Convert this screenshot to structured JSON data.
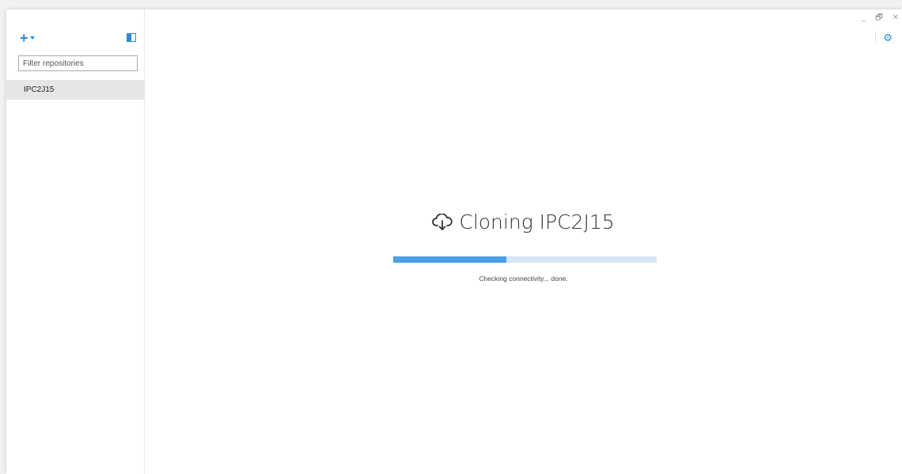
{
  "sidebar": {
    "add_button_icon": "plus-icon",
    "toggle_icon": "sidebar-toggle-icon",
    "filter": {
      "placeholder": "Filter repositories",
      "value": ""
    },
    "repositories": [
      {
        "label": "IPC2J15",
        "selected": true
      }
    ]
  },
  "window_controls": {
    "minimize": "_",
    "restore": "🗗",
    "close": "✕"
  },
  "settings_icon": "gear-icon",
  "main": {
    "title": "Cloning IPC2J15",
    "title_icon": "cloud-download-icon",
    "progress": 0.43,
    "status": "Checking connectivity... done."
  },
  "colors": {
    "accent": "#2b8ae0",
    "progress_fill": "#4a9fe6",
    "progress_track": "#d6e6f6",
    "selected_row": "#e6e6e6"
  }
}
